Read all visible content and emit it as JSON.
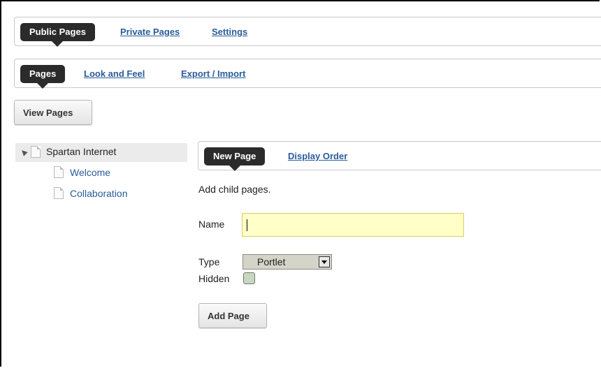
{
  "top_tabs": {
    "active": "Public Pages",
    "links": [
      "Private Pages",
      "Settings"
    ]
  },
  "sub_tabs": {
    "active": "Pages",
    "links": [
      "Look and Feel",
      "Export / Import"
    ]
  },
  "view_pages_button": "View Pages",
  "tree": {
    "root": "Spartan Internet",
    "children": [
      "Welcome",
      "Collaboration"
    ]
  },
  "panel_tabs": {
    "active": "New Page",
    "links": [
      "Display Order"
    ]
  },
  "form": {
    "intro": "Add child pages.",
    "name_label": "Name",
    "name_value": "",
    "type_label": "Type",
    "type_value": "Portlet",
    "hidden_label": "Hidden",
    "hidden_checked": false,
    "submit_label": "Add Page"
  },
  "colors": {
    "link": "#2a5c9a",
    "active_tab": "#2b2b2b",
    "input_bg": "#ffffc8"
  }
}
